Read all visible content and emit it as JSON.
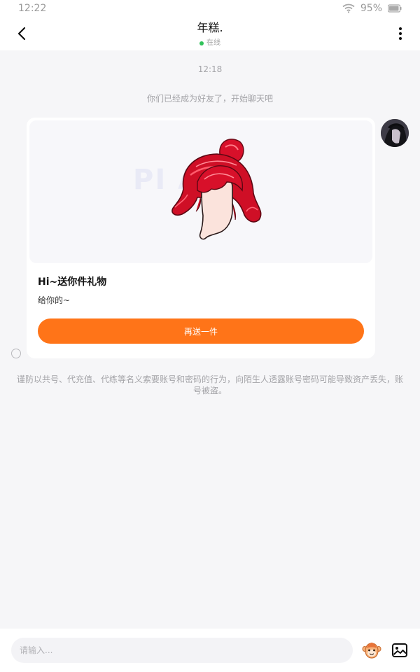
{
  "status_bar": {
    "time": "12:22",
    "battery": "95%",
    "icons": [
      "wifi-icon",
      "battery-icon"
    ]
  },
  "header": {
    "title": "年糕.",
    "status": "在线",
    "status_color": "#31c25a",
    "icons": [
      "back-arrow-icon",
      "more-vertical-icon"
    ]
  },
  "chat": {
    "timestamp": "12:18",
    "system_message": "你们已经成为好友了，开始聊天吧",
    "gift_card": {
      "image_icon": "red-hair-gift-icon",
      "title": "Hi~送你件礼物",
      "description": "给你的~",
      "button_label": "再送一件",
      "button_color": "#ff7418"
    },
    "warning": "谨防以共号、代充值、代练等名义索要账号和密码的行为，向陌生人透露账号密码可能导致资产丢失，账号被盗。"
  },
  "composer": {
    "placeholder": "请输入...",
    "icons": [
      "emoji-icon",
      "image-icon"
    ]
  }
}
